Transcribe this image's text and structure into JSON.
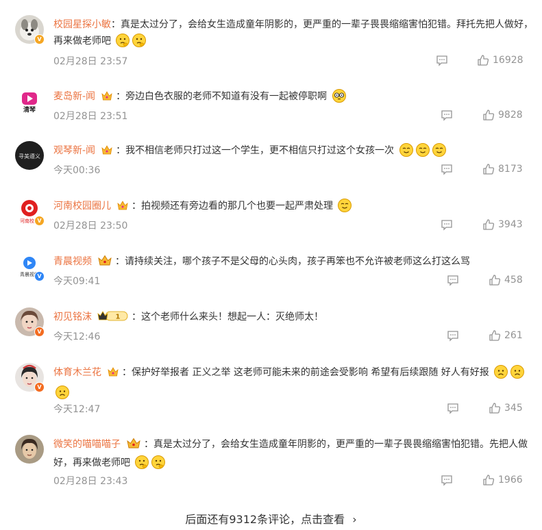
{
  "comments": [
    {
      "user": "校园星探小敏",
      "separator": "：",
      "text": "真是太过分了，会给女生造成童年阴影的，更严重的一辈子畏畏缩缩害怕犯错。拜托先把人做好，再来做老师吧",
      "emojis": [
        "thinking-emoji",
        "thinking-emoji"
      ],
      "time": "02月28日 23:57",
      "likes": "16928",
      "verified": "gold",
      "fan_badge": "none"
    },
    {
      "user": "麦岛新-闻",
      "separator": "：",
      "text": "旁边白色衣服的老师不知道有没有一起被停职啊",
      "emojis": [
        "nerd-emoji"
      ],
      "time": "02月28日 23:51",
      "likes": "9828",
      "verified": "none",
      "fan_badge": "crown"
    },
    {
      "user": "观琴新-闻",
      "separator": "：",
      "text": "我不相信老师只打过这一个学生，更不相信只打过这个女孩一次",
      "emojis": [
        "smile-emoji",
        "smile-emoji",
        "smile-emoji"
      ],
      "time": "今天00:36",
      "likes": "8173",
      "verified": "none",
      "fan_badge": "crown"
    },
    {
      "user": "河南校园圈儿",
      "separator": "：",
      "text": "拍视频还有旁边看的那几个也要一起严肃处理",
      "emojis": [
        "smile-emoji"
      ],
      "time": "02月28日 23:50",
      "likes": "3943",
      "verified": "gold",
      "fan_badge": "crown"
    },
    {
      "user": "青晨视频",
      "separator": "：",
      "text": "请持续关注，哪个孩子不是父母的心头肉，孩子再笨也不允许被老师这么打这么骂",
      "emojis": [],
      "time": "今天09:41",
      "likes": "458",
      "verified": "blue",
      "fan_badge": "crown-big"
    },
    {
      "user": "初见铭沫",
      "separator": "：",
      "text": "这个老师什么来头！想起一人：灭绝师太！",
      "emojis": [],
      "time": "今天12:46",
      "likes": "261",
      "verified": "orange",
      "fan_badge": "level",
      "fan_level": "1"
    },
    {
      "user": "体育木兰花",
      "separator": "：",
      "text": "保护好举报者 正义之举 这老师可能未来的前途会受影响 希望有后续跟随 好人有好报",
      "emojis": [
        "sad-emoji",
        "sad-emoji",
        "sad-emoji"
      ],
      "time": "今天12:47",
      "likes": "345",
      "verified": "orange",
      "fan_badge": "crown"
    },
    {
      "user": "微笑的喵喵喵子",
      "separator": "：",
      "text": "真是太过分了，会给女生造成童年阴影的，更严重的一辈子畏畏缩缩害怕犯错。先把人做好，再来做老师吧",
      "emojis": [
        "thinking-emoji",
        "thinking-emoji"
      ],
      "time": "02月28日 23:43",
      "likes": "1966",
      "verified": "none",
      "fan_badge": "crown-big"
    }
  ],
  "more_link": "后面还有9312条评论，点击查看",
  "more_chevron": "›",
  "colors": {
    "username": "#eb7340",
    "meta": "#939393",
    "text": "#333333"
  }
}
